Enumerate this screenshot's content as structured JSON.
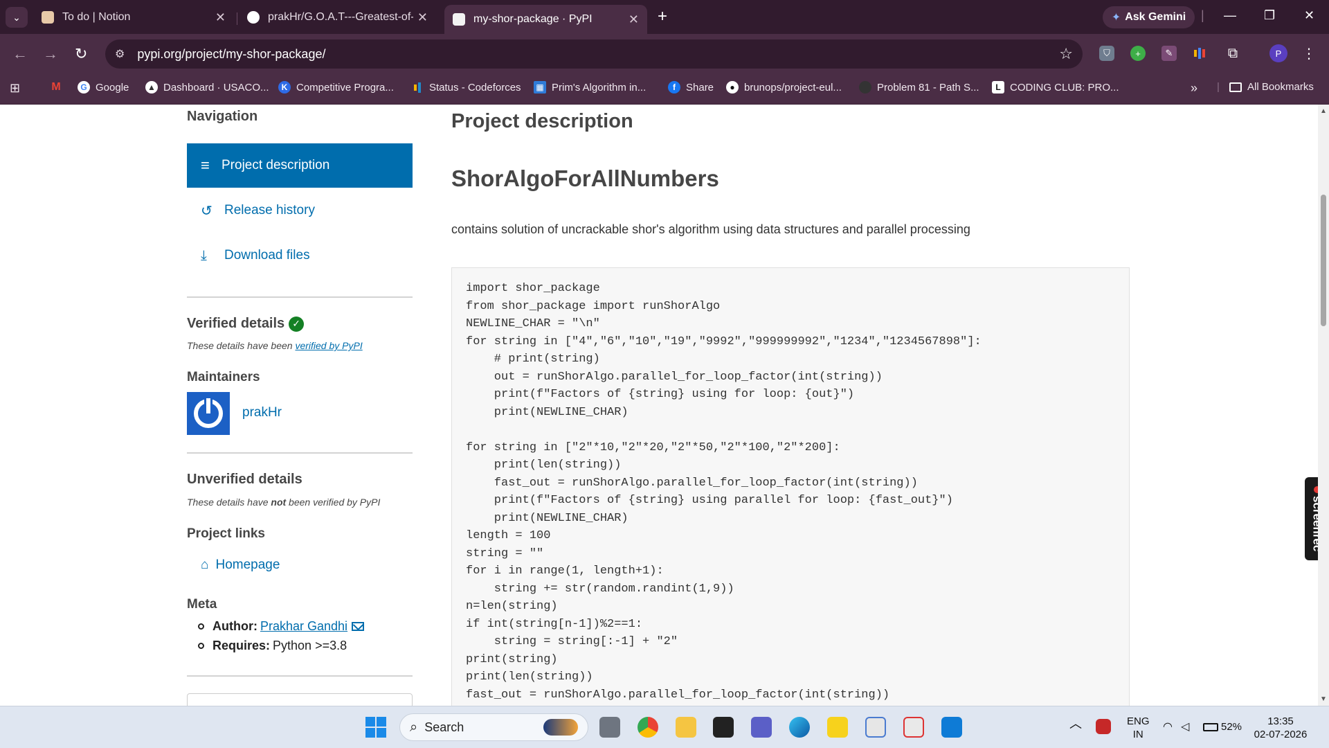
{
  "tabs": [
    {
      "title": "To do | Notion",
      "active": false
    },
    {
      "title": "prakHr/G.O.A.T---Greatest-of-a",
      "active": false
    },
    {
      "title": "my-shor-package · PyPI",
      "active": true
    }
  ],
  "gemini_label": "Ask Gemini",
  "address": {
    "url": "pypi.org/project/my-shor-package/"
  },
  "profile_initial": "P",
  "bookmarks": [
    "Google",
    "Dashboard · USACO...",
    "Competitive Progra...",
    "Status - Codeforces",
    "Prim's Algorithm in...",
    "Share",
    "brunops/project-eul...",
    "Problem 81 - Path S...",
    "CODING CLUB: PRO..."
  ],
  "all_bookmarks": "All Bookmarks",
  "sidebar": {
    "navigation_heading": "Navigation",
    "nav_items": [
      "Project description",
      "Release history",
      "Download files"
    ],
    "verified_heading": "Verified details",
    "verified_note_prefix": "These details have been ",
    "verified_note_link": "verified by PyPI",
    "maintainers_heading": "Maintainers",
    "maintainer": "prakHr",
    "unverified_heading": "Unverified details",
    "unverified_prefix": "These details have ",
    "unverified_bold": "not",
    "unverified_suffix": " been verified by PyPI",
    "project_links_heading": "Project links",
    "homepage": "Homepage",
    "meta_heading": "Meta",
    "author_label": "Author:",
    "author_name": "Prakhar Gandhi",
    "requires_label": "Requires:",
    "requires_value": "Python >=3.8"
  },
  "main": {
    "section_title": "Project description",
    "package_heading": "ShorAlgoForAllNumbers",
    "description": "contains solution of uncrackable shor's algorithm using data structures and parallel processing",
    "code_lines": [
      "import shor_package",
      "from shor_package import runShorAlgo",
      "NEWLINE_CHAR = \"\\n\"",
      "for string in [\"4\",\"6\",\"10\",\"19\",\"9992\",\"999999992\",\"1234\",\"1234567898\"]:",
      "    # print(string)",
      "    out = runShorAlgo.parallel_for_loop_factor(int(string))",
      "    print(f\"Factors of {string} using for loop: {out}\")",
      "    print(NEWLINE_CHAR)",
      "",
      "for string in [\"2\"*10,\"2\"*20,\"2\"*50,\"2\"*100,\"2\"*200]:",
      "    print(len(string))",
      "    fast_out = runShorAlgo.parallel_for_loop_factor(int(string))",
      "    print(f\"Factors of {string} using parallel for loop: {fast_out}\")",
      "    print(NEWLINE_CHAR)",
      "length = 100",
      "string = \"\"",
      "for i in range(1, length+1):",
      "    string += str(random.randint(1,9))",
      "n=len(string)",
      "if int(string[n-1])%2==1:",
      "    string = string[:-1] + \"2\"",
      "print(string)",
      "print(len(string))",
      "fast_out = runShorAlgo.parallel_for_loop_factor(int(string))"
    ]
  },
  "screenrec": "screenrec",
  "taskbar": {
    "search_label": "Search",
    "lang_top": "ENG",
    "lang_bottom": "IN",
    "battery": "52%",
    "time": "13:35",
    "date": "02-07-2026"
  }
}
